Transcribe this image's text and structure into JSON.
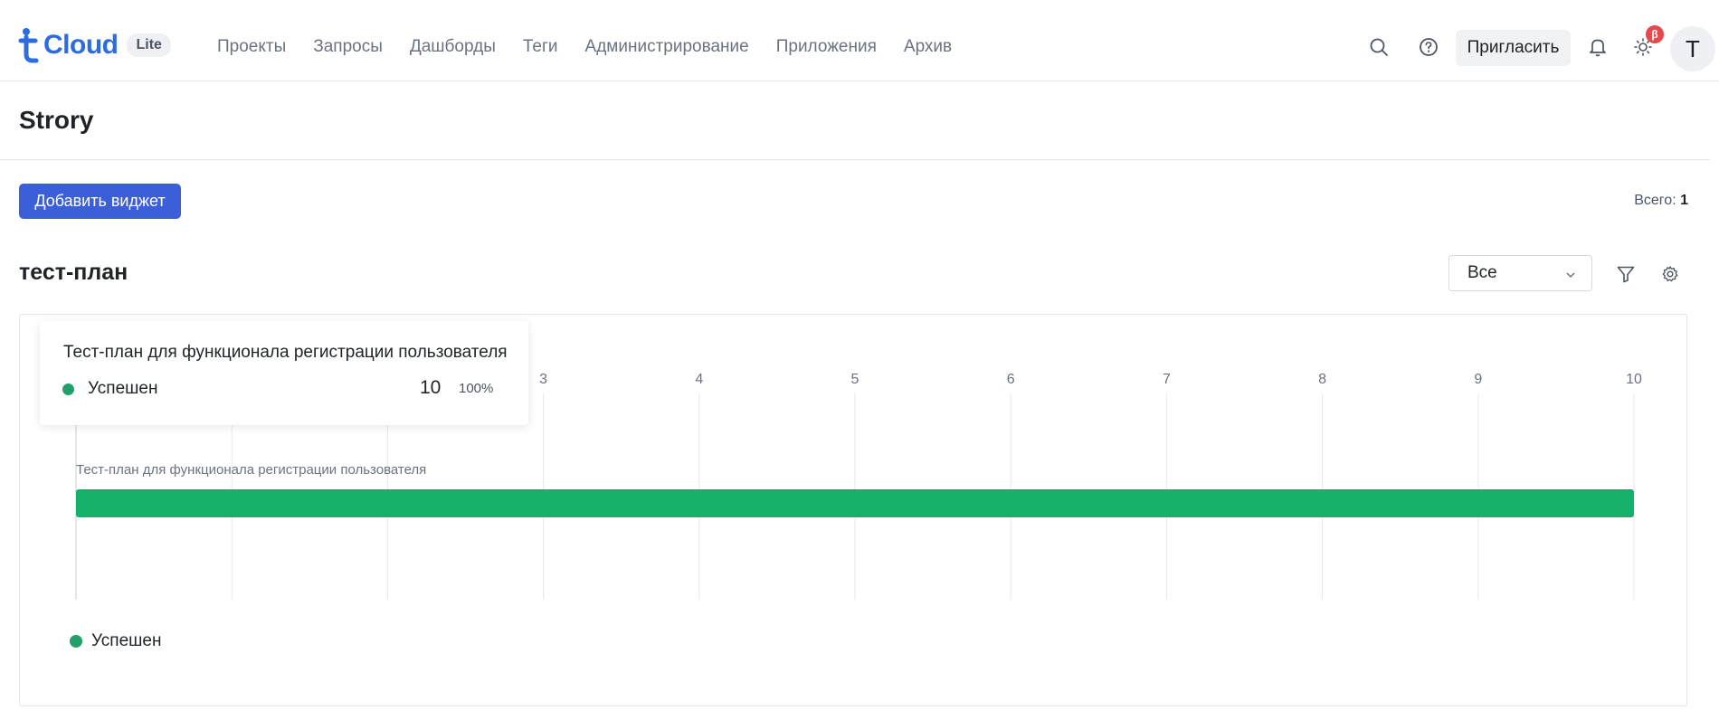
{
  "brand": {
    "logo_text": "Cloud",
    "edition": "Lite",
    "accent": "#2d6cdf"
  },
  "nav": [
    "Проекты",
    "Запросы",
    "Дашборды",
    "Теги",
    "Администрирование",
    "Приложения",
    "Архив"
  ],
  "header": {
    "invite_label": "Пригласить",
    "beta_label": "β",
    "avatar_initial": "T"
  },
  "page": {
    "title": "Strory",
    "add_widget_label": "Добавить виджет",
    "total_label": "Всего:",
    "total_value": "1"
  },
  "widget": {
    "title": "тест-план",
    "filter_value": "Все",
    "tooltip": {
      "title": "Тест-план для функционала регистрации пользователя",
      "status": "Успешен",
      "value": "10",
      "percent": "100%"
    },
    "legend": [
      {
        "label": "Успешен",
        "color": "#22a06b"
      }
    ]
  },
  "chart_data": {
    "type": "bar",
    "orientation": "horizontal",
    "categories": [
      "Тест-план для функционала регистрации пользователя"
    ],
    "series": [
      {
        "name": "Успешен",
        "values": [
          10
        ],
        "color": "#15b06a"
      }
    ],
    "x_ticks": [
      0,
      1,
      2,
      3,
      4,
      5,
      6,
      7,
      8,
      9,
      10
    ],
    "xlim": [
      0,
      10
    ],
    "grid": true,
    "legend_position": "bottom-left"
  }
}
